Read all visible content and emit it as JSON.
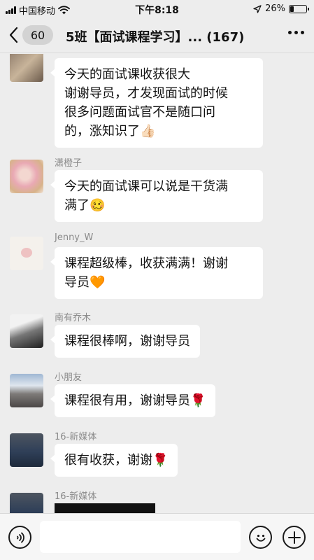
{
  "status_bar": {
    "carrier": "中国移动",
    "time": "下午8:18",
    "battery_text": "26%",
    "battery_level": 0.26,
    "icons": [
      "signal-icon",
      "wifi-icon",
      "location-arrow-icon",
      "battery-icon"
    ]
  },
  "nav": {
    "back_icon": "chevron-left-icon",
    "unread_count": "60",
    "title": "5班【面试课程学习】... (167)",
    "more_icon": "ellipsis-icon"
  },
  "messages": [
    {
      "sender": "",
      "lines": [
        "今天的面试课收获很大",
        "谢谢导员，才发现面试的时候",
        "很多问题面试官不是随口问",
        "的，涨知识了"
      ],
      "emoji": "👍🏻"
    },
    {
      "sender": "潇橙子",
      "lines": [
        "今天的面试课可以说是干货满",
        "满了"
      ],
      "emoji": "🥴"
    },
    {
      "sender": "Jenny_W",
      "lines": [
        "课程超级棒，收获满满！谢谢",
        "导员"
      ],
      "emoji": "🧡"
    },
    {
      "sender": "南有乔木",
      "lines": [
        "课程很棒啊，谢谢导员"
      ],
      "emoji": ""
    },
    {
      "sender": "小朋友",
      "lines": [
        "课程很有用，谢谢导员"
      ],
      "emoji": "🌹"
    },
    {
      "sender": "16-新媒体",
      "lines": [
        "很有收获，谢谢"
      ],
      "emoji": "🌹"
    },
    {
      "sender": "16-新媒体",
      "lines": [],
      "emoji": ""
    }
  ],
  "input_bar": {
    "voice_icon": "voice-icon",
    "emoji_icon": "smiley-icon",
    "plus_icon": "plus-icon",
    "input_value": ""
  },
  "colors": {
    "background": "#ededed",
    "bubble": "#ffffff",
    "sender_text": "#8a8a8a",
    "input_bar": "#f6f6f6"
  }
}
